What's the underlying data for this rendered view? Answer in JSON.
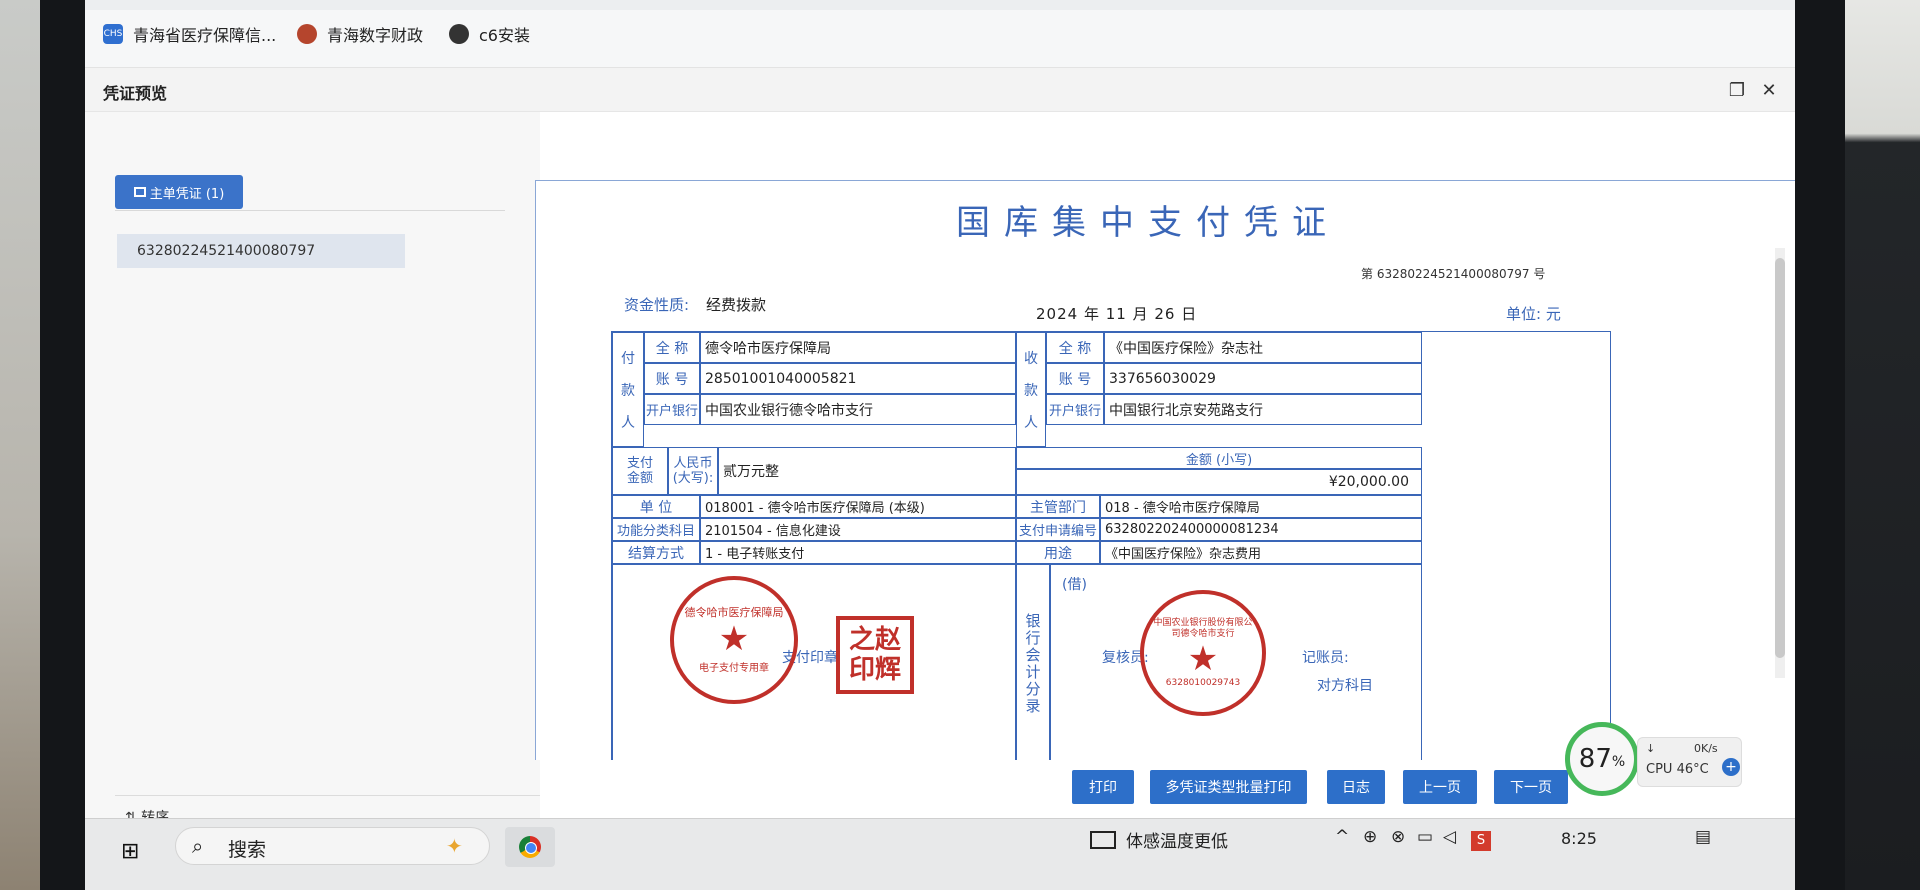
{
  "bookmarks": [
    {
      "icon": "chs-icon",
      "icon_text": "CHS",
      "label": "青海省医疗保障信..."
    },
    {
      "icon": "qh-finance-icon",
      "icon_text": "",
      "label": "青海数字财政"
    },
    {
      "icon": "globe-icon",
      "icon_text": "",
      "label": "c6安装"
    }
  ],
  "dialog": {
    "title": "凭证预览",
    "restore_symbol": "❐",
    "close_symbol": "✕"
  },
  "left": {
    "tab_label": "主单凭证 (1)",
    "voucher_id": "63280224521400080797",
    "sort_label": "⇅ 转序"
  },
  "voucher": {
    "title": "国库集中支付凭证",
    "number": "第 63280224521400080797 号",
    "fund_nature_label": "资金性质:",
    "fund_nature": "经费拨款",
    "date": "2024 年 11 月 26 日",
    "unit": "单位:  元",
    "payer_label": [
      "付",
      "款",
      "人"
    ],
    "payee_label": [
      "收",
      "款",
      "人"
    ],
    "name_label": "全  称",
    "account_label": "账  号",
    "bank_label": "开户银行",
    "payer_name": "德令哈市医疗保障局",
    "payer_account": "28501001040005821",
    "payer_bank": "中国农业银行德令哈市支行",
    "payee_name": "《中国医疗保险》杂志社",
    "payee_account": "337656030029",
    "payee_bank": "中国银行北京安苑路支行",
    "pay_amount_label": "支付\n金额",
    "rmb_label": "人民币\n(大写):",
    "amount_caps": "贰万元整",
    "amount_small_label": "金额 (小写)",
    "amount_small": "¥20,000.00",
    "dept_label": "单  位",
    "dept": "018001 - 德令哈市医疗保障局 (本级)",
    "supervisor_label": "主管部门",
    "supervisor": "018 - 德令哈市医疗保障局",
    "func_label": "功能分类科目",
    "func": "2101504 - 信息化建设",
    "apply_no_label": "支付申请编号",
    "apply_no": "632802202400000081234",
    "settle_label": "结算方式",
    "settle": "1 - 电子转账支付",
    "purpose_label": "用途",
    "purpose": "《中国医疗保险》杂志费用",
    "pay_seal_label": "支付印章",
    "bank_accounting_label": "银行会计分录",
    "debit_label": "(借)",
    "reviewer_label": "复核员:",
    "bookkeeper_label": "记账员:",
    "counter_subject_label": "对方科目"
  },
  "seals": {
    "round_left_text": "德令哈市医疗保障局",
    "round_left_sub": "电子支付专用章",
    "square_text": "之赵\n印辉",
    "round_right_text": "中国农业银行股份有限公司德令哈市支行",
    "round_right_code": "6328010029743"
  },
  "buttons": {
    "print": "打印",
    "batch_print": "多凭证类型批量打印",
    "log": "日志",
    "prev": "上一页",
    "next": "下一页"
  },
  "cpu": {
    "usage": "87",
    "pct": "%",
    "net": "0K/s",
    "temp": "CPU 46°C"
  },
  "taskbar": {
    "search_text": "搜索",
    "weather_text": "体感温度更低",
    "time": "8:25"
  },
  "colors": {
    "voucher_blue": "#3a66b7",
    "seal_red": "#c0302a",
    "button_blue": "#2d6fc9",
    "cpu_ring_green": "#46b85a"
  }
}
